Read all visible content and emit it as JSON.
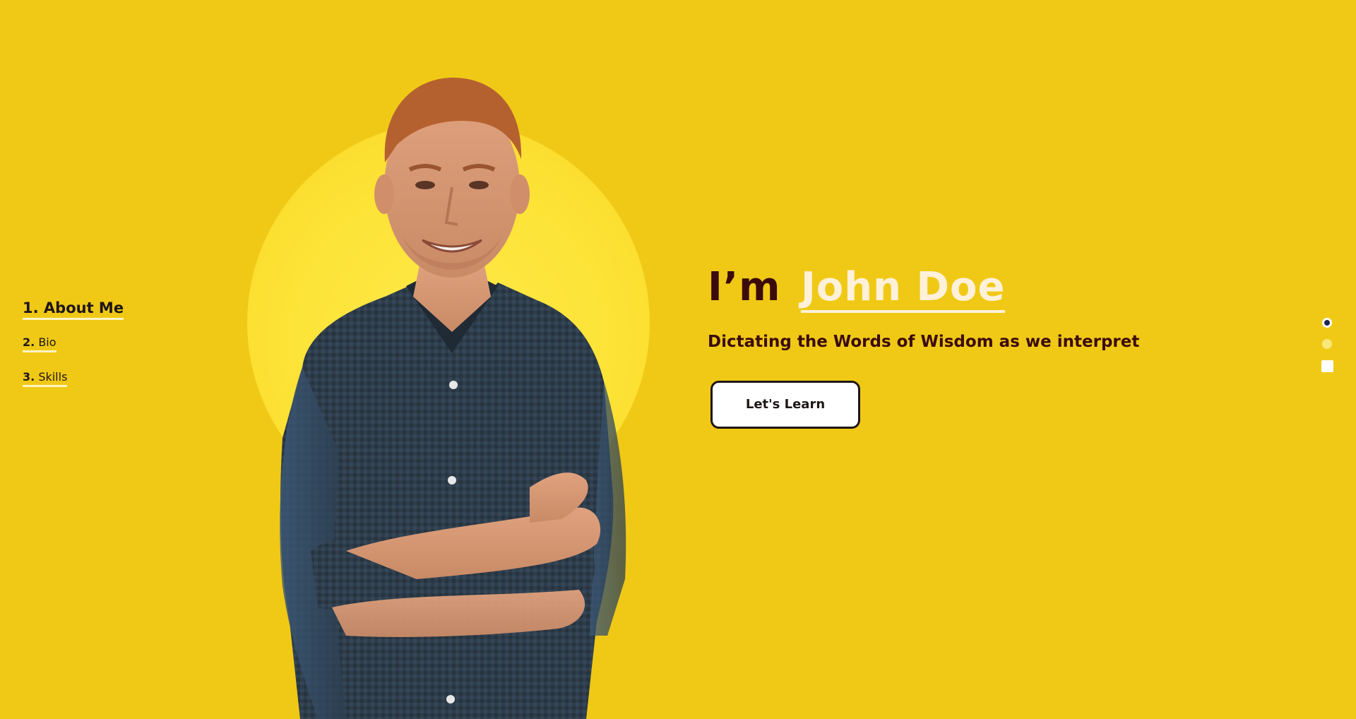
{
  "side_nav": {
    "items": [
      {
        "number": "1.",
        "label": "About Me",
        "active": true
      },
      {
        "number": "2.",
        "label": "Bio",
        "active": false
      },
      {
        "number": "3.",
        "label": "Skills",
        "active": false
      }
    ]
  },
  "hero": {
    "greeting": "I’m",
    "name": "John Doe",
    "tagline": "Dictating the Words of Wisdom as we interpret",
    "cta_label": "Let's Learn"
  },
  "pager": {
    "count": 3,
    "active_index": 0
  },
  "colors": {
    "background": "#f0c916",
    "halo": "#fde336",
    "title_text": "#3b0b0b",
    "name_highlight": "#fff1d9",
    "nav_underline": "#fff4c2",
    "active_dot": "#1f2350"
  },
  "icons": {
    "portrait": "person-photo"
  }
}
